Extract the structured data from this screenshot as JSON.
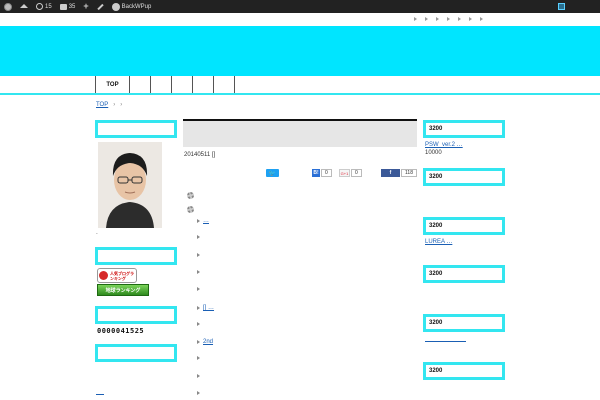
{
  "adminbar": {
    "updates_count": "15",
    "comments_count": "35",
    "plugin_label": "BackWPup"
  },
  "nav": {
    "top_label": "TOP"
  },
  "breadcrumb": {
    "home_label": "TOP",
    "sep1": "›",
    "sep2": "›"
  },
  "left_sidebar": {
    "caption": "-",
    "banner1_text": "人気ブログランキング",
    "banner2_text": "地球ランキング",
    "counter": "0000041525"
  },
  "post": {
    "date_line": "20140511 []",
    "share": {
      "twitter_icon": "twitter-bird-icon",
      "hatena_count": "0",
      "google_label": "G+1",
      "google_count": "0",
      "facebook_label": "f",
      "facebook_count": "118"
    },
    "list": [
      {
        "text": "…",
        "link": true
      },
      {
        "text": "",
        "link": false
      },
      {
        "text": "",
        "link": false
      },
      {
        "text": "",
        "link": false
      },
      {
        "text": "",
        "link": false
      },
      {
        "text": "[] …",
        "link": true
      },
      {
        "text": "",
        "link": false
      },
      {
        "text": "2nd",
        "link": true
      },
      {
        "text": "",
        "link": false
      },
      {
        "text": "",
        "link": false
      },
      {
        "text": "",
        "link": false
      }
    ]
  },
  "right_sidebar": {
    "box1": "3200",
    "link1": "PSW_ver.2 …",
    "text1": "10000",
    "box2": "3200",
    "box3": "3200",
    "link2": "LUREA …",
    "box4": "3200",
    "box5": "3200",
    "box6": "3200"
  },
  "colors": {
    "accent_cyan": "#00e5ff",
    "box_border": "#33e6f0",
    "adminbar_bg": "#222222",
    "link": "#1a5fb4"
  }
}
